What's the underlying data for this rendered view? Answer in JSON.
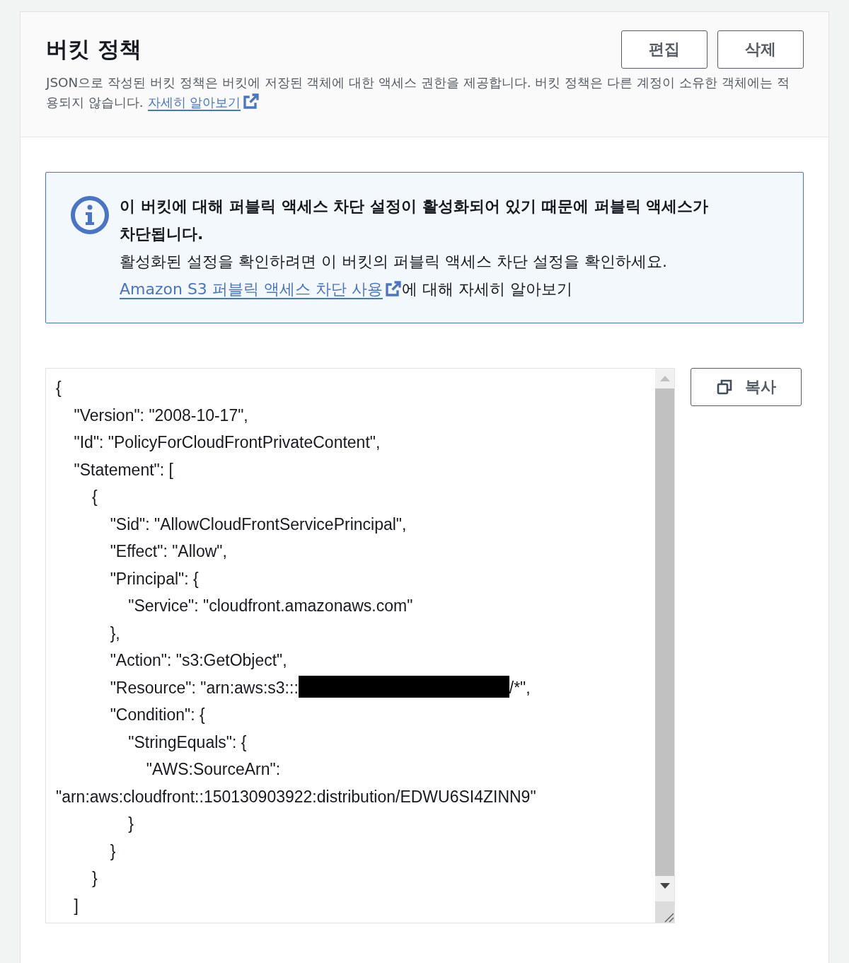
{
  "header": {
    "title": "버킷 정책",
    "buttons": [
      "편집",
      "삭제"
    ],
    "description": "JSON으로 작성된 버킷 정책은 버킷에 저장된 객체에 대한 액세스 권한을 제공합니다. 버킷 정책은 다른 계정이 소유한 객체에는 적용되지 않습니다.",
    "link": "자세히 알아보기"
  },
  "alert": {
    "title": "이 버킷에 대해 퍼블릭 액세스 차단 설정이 활성화되어 있기 때문에 퍼블릭 액세스가 차단됩니다.",
    "message": "활성화된 설정을 확인하려면 이 버킷의 퍼블릭 액세스 차단 설정을 확인하세요.",
    "link": "Amazon S3 퍼블릭 액세스 차단 사용",
    "link_suffix": "에 대해 자세히 알아보기"
  },
  "policy": {
    "copy_button": "복사",
    "lines": [
      {
        "text": "{"
      },
      {
        "text": "    \"Version\": \"2008-10-17\","
      },
      {
        "text": "    \"Id\": \"PolicyForCloudFrontPrivateContent\","
      },
      {
        "text": "    \"Statement\": ["
      },
      {
        "text": "        {"
      },
      {
        "text": "            \"Sid\": \"AllowCloudFrontServicePrincipal\","
      },
      {
        "text": "            \"Effect\": \"Allow\","
      },
      {
        "text": "            \"Principal\": {"
      },
      {
        "text": "                \"Service\": \"cloudfront.amazonaws.com\""
      },
      {
        "text": "            },"
      },
      {
        "text": "            \"Action\": \"s3:GetObject\","
      },
      {
        "text": "            \"Resource\": \"arn:aws:s3:::",
        "redacted": true,
        "text_after": "/*\","
      },
      {
        "text": "            \"Condition\": {"
      },
      {
        "text": "                \"StringEquals\": {"
      },
      {
        "text": "                    \"AWS:SourceArn\":"
      },
      {
        "text": "\"arn:aws:cloudfront::150130903922:distribution/EDWU6SI4ZINN9\""
      },
      {
        "text": "                }"
      },
      {
        "text": "            }"
      },
      {
        "text": "        }"
      },
      {
        "text": "    ]"
      }
    ]
  }
}
